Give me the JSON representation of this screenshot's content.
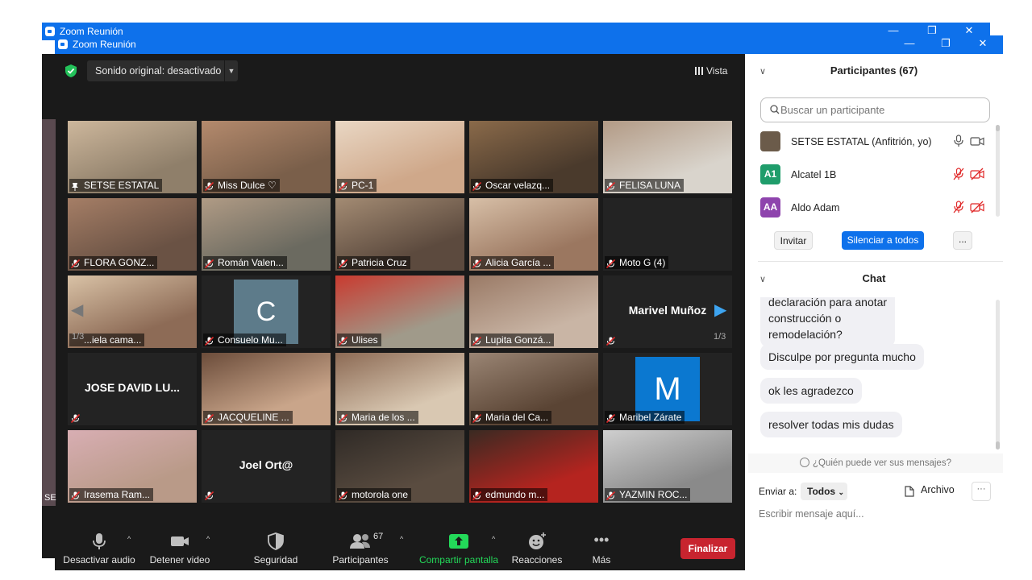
{
  "window_back": {
    "title": "Zoom Reunión",
    "minimize": "—",
    "restore": "❐",
    "close": "✕"
  },
  "window_front": {
    "title": "Zoom Reunión",
    "minimize": "—",
    "restore": "❐",
    "close": "✕"
  },
  "top_bar": {
    "sound_label": "Sonido original: desactivado",
    "view_label": "Vista"
  },
  "side_sliver": {
    "label": "SE"
  },
  "gallery": {
    "page_left": "1/3",
    "page_right": "1/3",
    "tiles": [
      {
        "name": "SETSE ESTATAL",
        "muted": false,
        "pinned": true,
        "photo": "#8f7f6a",
        "photo2": "#cdb79c"
      },
      {
        "name": "Miss Dulce ♡",
        "muted": true,
        "photo": "#7a5f4a",
        "photo2": "#b48a6d"
      },
      {
        "name": "PC-1",
        "muted": true,
        "photo": "#cfa88a",
        "photo2": "#e9d7c4"
      },
      {
        "name": "Oscar velazq...",
        "muted": true,
        "photo": "#4a3a2c",
        "photo2": "#8a6a4a"
      },
      {
        "name": "FELISA LUNA",
        "muted": true,
        "photo": "#d9d4cc",
        "photo2": "#b29a85"
      },
      {
        "name": "FLORA GONZ...",
        "muted": true,
        "photo": "#6a5244",
        "photo2": "#a57e66"
      },
      {
        "name": "Román Valen...",
        "muted": true,
        "photo": "#6b6a60",
        "photo2": "#b09b85"
      },
      {
        "name": "Patricia Cruz",
        "muted": true,
        "photo": "#5c4a3e",
        "photo2": "#a38b73"
      },
      {
        "name": "Alicia García ...",
        "muted": true,
        "photo": "#9b7760",
        "photo2": "#d7bfa7"
      },
      {
        "name": "Moto G (4)",
        "muted": true,
        "photo": "#232323",
        "photo2": "#232323"
      },
      {
        "name": "...iela cama...",
        "muted": false,
        "photo": "#8d6b56",
        "photo2": "#d9c2a6"
      },
      {
        "name": "Consuelo Mu...",
        "muted": true,
        "avatar": "C"
      },
      {
        "name": "Ulises",
        "muted": true,
        "photo": "#a09a8a",
        "photo2": "#c93a2f"
      },
      {
        "name": "Lupita Gonzá...",
        "muted": true,
        "photo": "#c9b5a5",
        "photo2": "#9a7a66"
      },
      {
        "name": "",
        "muted": true,
        "display": "Marivel  Muñoz"
      },
      {
        "name": "",
        "muted": true,
        "display": "JOSE DAVID LU..."
      },
      {
        "name": "JACQUELINE ...",
        "muted": true,
        "photo": "#c9a58a",
        "photo2": "#6b4c3a"
      },
      {
        "name": "Maria de los ...",
        "muted": true,
        "photo": "#d9c8b2",
        "photo2": "#8c6a54"
      },
      {
        "name": "Maria del Ca...",
        "muted": true,
        "photo": "#5a4434",
        "photo2": "#9a8574"
      },
      {
        "name": "Maribel Zárate",
        "muted": true,
        "avatar": "M"
      },
      {
        "name": "Irasema Ram...",
        "muted": true,
        "photo": "#b99a88",
        "photo2": "#d8aeb3"
      },
      {
        "name": "",
        "muted": true,
        "display": "Joel Ort@"
      },
      {
        "name": "motorola one",
        "muted": true,
        "photo": "#5a4c40",
        "photo2": "#2f2a26"
      },
      {
        "name": "edmundo m...",
        "muted": true,
        "photo": "#b5241f",
        "photo2": "#3a2a22"
      },
      {
        "name": "YAZMIN ROC...",
        "muted": true,
        "photo": "#8a8a8a",
        "photo2": "#cfcfcf"
      }
    ]
  },
  "toolbar": {
    "audio_label": "Desactivar audio",
    "video_label": "Detener video",
    "security_label": "Seguridad",
    "participants_label": "Participantes",
    "participants_count": "67",
    "share_label": "Compartir pantalla",
    "reactions_label": "Reacciones",
    "more_label": "Más",
    "end_label": "Finalizar",
    "colors": {
      "share_green": "#23d959",
      "end_red": "#c8242f"
    }
  },
  "participants_panel": {
    "title": "Participantes (67)",
    "search_placeholder": "Buscar un participante",
    "rows": [
      {
        "initials": "",
        "name": "SETSE ESTATAL (Anfitrión, yo)",
        "color": "#6b5b4a"
      },
      {
        "initials": "A1",
        "name": "Alcatel 1B",
        "color": "#1f9d6b"
      },
      {
        "initials": "AA",
        "name": "Aldo Adam",
        "color": "#8e44ad"
      }
    ],
    "invite_label": "Invitar",
    "mute_all_label": "Silenciar a todos",
    "more_label": "..."
  },
  "chat_panel": {
    "title": "Chat",
    "messages": [
      "declaración para anotar\nconstrucción o\nremodelación?",
      "Disculpe por pregunta mucho",
      "ok les agradezco",
      "resolver todas mis dudas"
    ],
    "who_can_see": "¿Quién puede ver sus mensajes?",
    "send_to_label": "Enviar a:",
    "send_to_value": "Todos",
    "file_label": "Archivo",
    "more_label": "···",
    "input_placeholder": "Escribir mensaje aquí..."
  }
}
